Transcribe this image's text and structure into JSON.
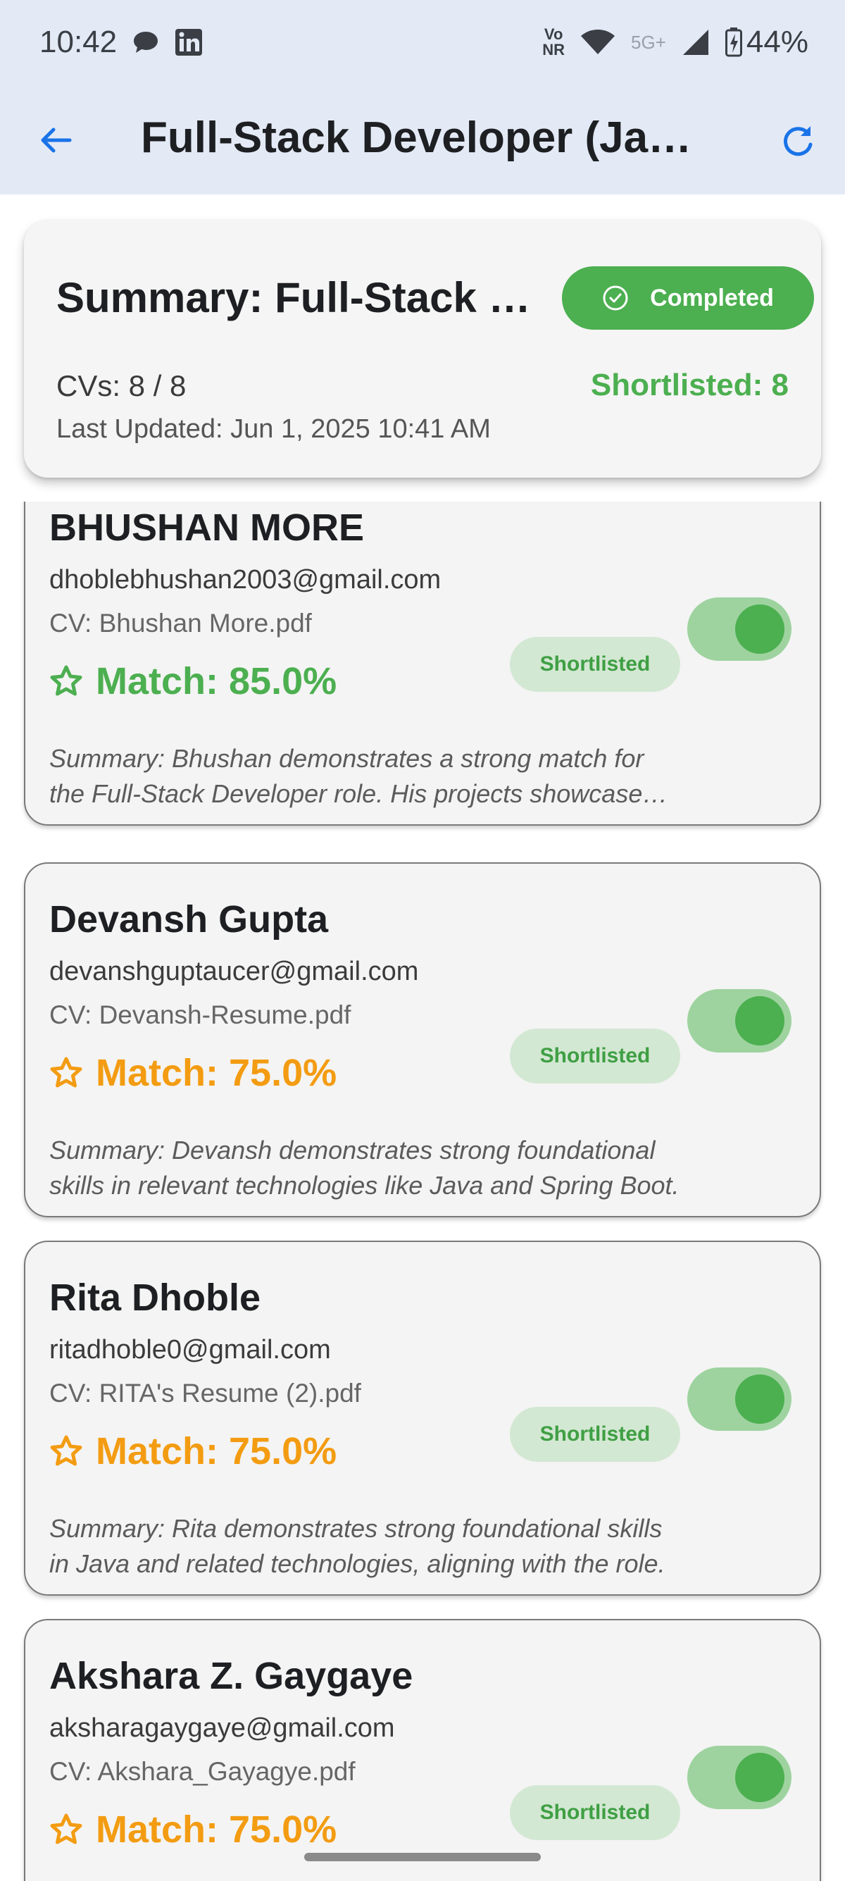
{
  "status_bar": {
    "time": "10:42",
    "volte_top": "Vo",
    "volte_bottom": "NR",
    "network": "5G+",
    "battery": "44%"
  },
  "app_bar": {
    "title": "Full-Stack Developer (Java Developer)",
    "back_icon": "arrow-back-icon",
    "refresh_icon": "refresh-icon"
  },
  "summary": {
    "title": "Summary: Full-Stack Developer (Java Developer)",
    "status": "Completed",
    "cvs": "CVs: 8 / 8",
    "shortlisted": "Shortlisted: 8",
    "last_updated": "Last Updated: Jun 1, 2025 10:41 AM"
  },
  "colors": {
    "accent_blue": "#1a73e8",
    "green": "#4caf50",
    "orange": "#f39c12",
    "appbar_bg": "#e3eaf6"
  },
  "candidates": [
    {
      "name": "BHUSHAN MORE",
      "email": "dhoblebhushan2003@gmail.com",
      "cv": "CV: Bhushan More.pdf",
      "match": "Match: 85.0%",
      "match_color": "#4caf50",
      "badge": "Shortlisted",
      "shortlisted": true,
      "summary": "Summary: Bhushan demonstrates a strong match for the Full-Stack Developer role. His projects showcase relevant experience."
    },
    {
      "name": "Devansh Gupta",
      "email": "devanshguptaucer@gmail.com",
      "cv": "CV: Devansh-Resume.pdf",
      "match": "Match: 75.0%",
      "match_color": "#f39c12",
      "badge": "Shortlisted",
      "shortlisted": true,
      "summary": "Summary: Devansh demonstrates strong foundational skills in relevant technologies like Java and Spring Boot."
    },
    {
      "name": "Rita Dhoble",
      "email": "ritadhoble0@gmail.com",
      "cv": "CV: RITA's Resume (2).pdf",
      "match": "Match: 75.0%",
      "match_color": "#f39c12",
      "badge": "Shortlisted",
      "shortlisted": true,
      "summary": "Summary: Rita demonstrates strong foundational skills in Java and related technologies, aligning with the role."
    },
    {
      "name": "Akshara Z. Gaygaye",
      "email": "aksharagaygaye@gmail.com",
      "cv": "CV: Akshara_Gayagye.pdf",
      "match": "Match: 75.0%",
      "match_color": "#f39c12",
      "badge": "Shortlisted",
      "shortlisted": true,
      "summary": ""
    }
  ]
}
